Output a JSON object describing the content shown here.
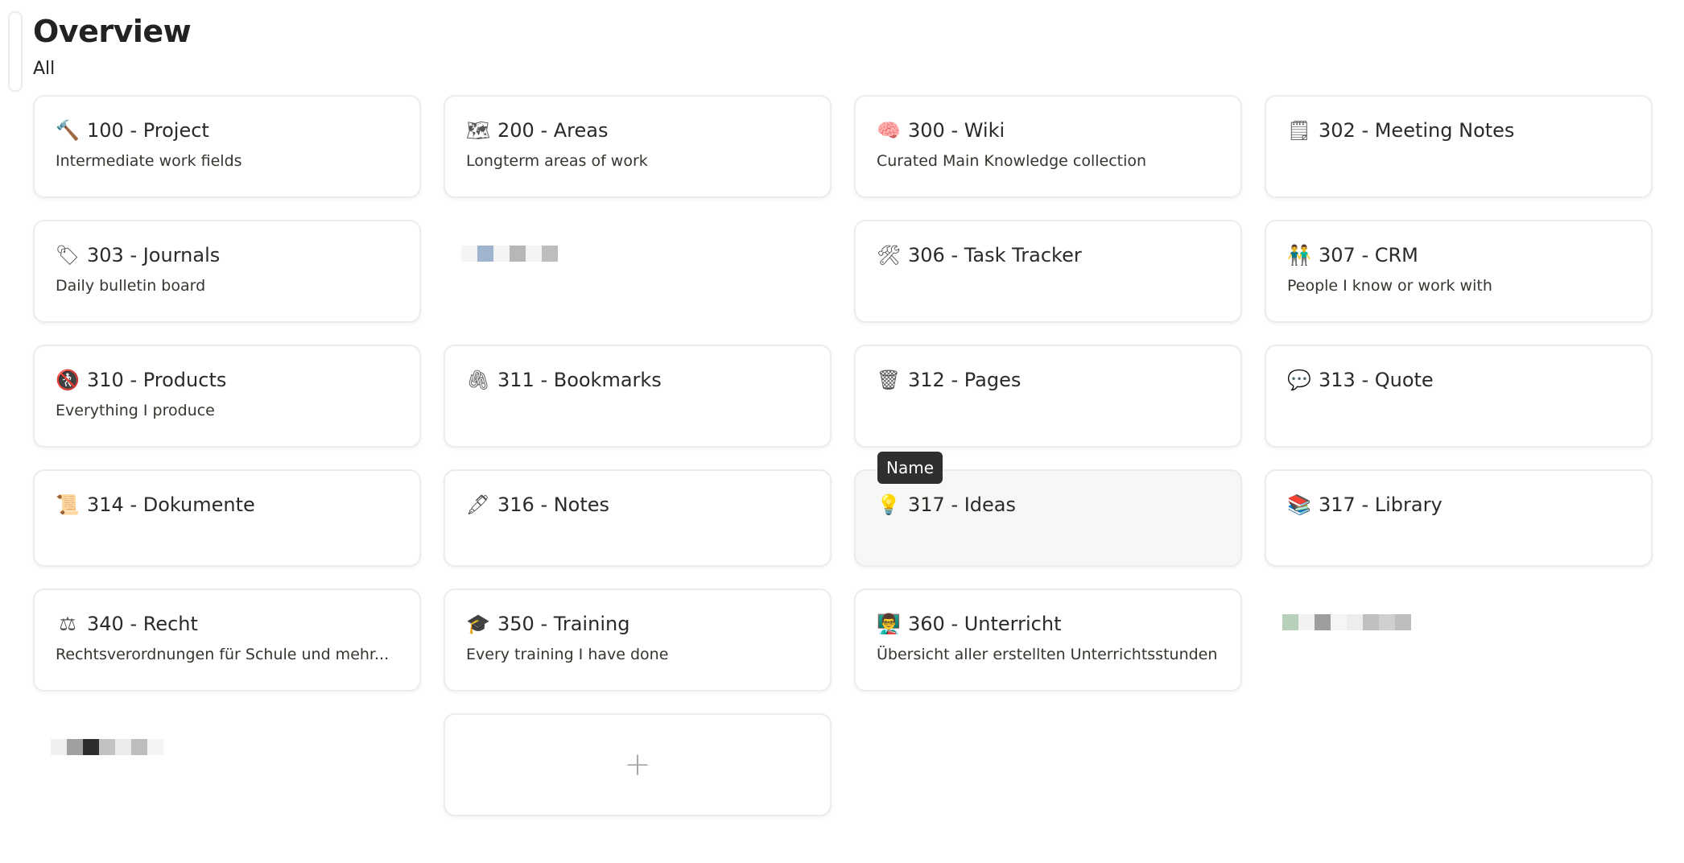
{
  "page": {
    "title": "Overview",
    "view_tab": "All"
  },
  "tooltip": "Name",
  "add_card_symbol": "+",
  "cards": [
    {
      "icon": "hammer-icon",
      "glyph": "🔨",
      "title": "100 - Project",
      "description": "Intermediate work fields"
    },
    {
      "icon": "map-icon",
      "glyph": "🗺",
      "title": "200 - Areas",
      "description": "Longterm areas of work"
    },
    {
      "icon": "brain-icon",
      "glyph": "🧠",
      "title": "300 - Wiki",
      "description": "Curated Main Knowledge collection"
    },
    {
      "icon": "spiral-notepad-icon",
      "glyph": "🗒",
      "title": "302 - Meeting Notes",
      "description": ""
    },
    {
      "icon": "label-tag-icon",
      "glyph": "🏷",
      "title": "303 - Journals",
      "description": "Daily bulletin board"
    },
    {
      "redacted": true
    },
    {
      "icon": "hammer-and-wrench-icon",
      "glyph": "🛠",
      "title": "306 - Task Tracker",
      "description": ""
    },
    {
      "icon": "people-holding-hands-icon",
      "glyph": "👬",
      "title": "307 - CRM",
      "description": "People I know or work with"
    },
    {
      "icon": "no-pedestrians-icon",
      "glyph": "🚷",
      "title": "310 - Products",
      "description": "Everything I produce"
    },
    {
      "icon": "paperclips-icon",
      "glyph": "🖇",
      "title": "311 - Bookmarks",
      "description": ""
    },
    {
      "icon": "wastebasket-icon",
      "glyph": "🗑",
      "title": "312 - Pages",
      "description": ""
    },
    {
      "icon": "speech-balloon-icon",
      "glyph": "💬",
      "title": "313 - Quote",
      "description": ""
    },
    {
      "icon": "scroll-icon",
      "glyph": "📜",
      "title": "314 - Dokumente",
      "description": ""
    },
    {
      "icon": "fountain-pen-icon",
      "glyph": "🖋",
      "title": "316 - Notes",
      "description": ""
    },
    {
      "icon": "light-bulb-icon",
      "glyph": "💡",
      "title": "317 - Ideas",
      "description": "",
      "hover": true
    },
    {
      "icon": "books-icon",
      "glyph": "📚",
      "title": "317 - Library",
      "description": ""
    },
    {
      "icon": "balance-scale-icon",
      "glyph": "⚖",
      "title": "340 - Recht",
      "description": "Rechtsverordnungen für Schule und mehr..."
    },
    {
      "icon": "graduation-cap-icon",
      "glyph": "🎓",
      "title": "350 - Training",
      "description": "Every training I have done"
    },
    {
      "icon": "teacher-icon",
      "glyph": "👨‍🏫",
      "title": "360 - Unterricht",
      "description": "Übersicht aller erstellten Unterrichtsstunden"
    },
    {
      "redacted": true
    },
    {
      "redacted": true
    },
    {
      "add": true
    }
  ],
  "colors": {
    "card_border": "#ececea",
    "hover_bg": "#f7f7f5",
    "tooltip_bg": "#2f2f2f",
    "text": "#37352f"
  }
}
